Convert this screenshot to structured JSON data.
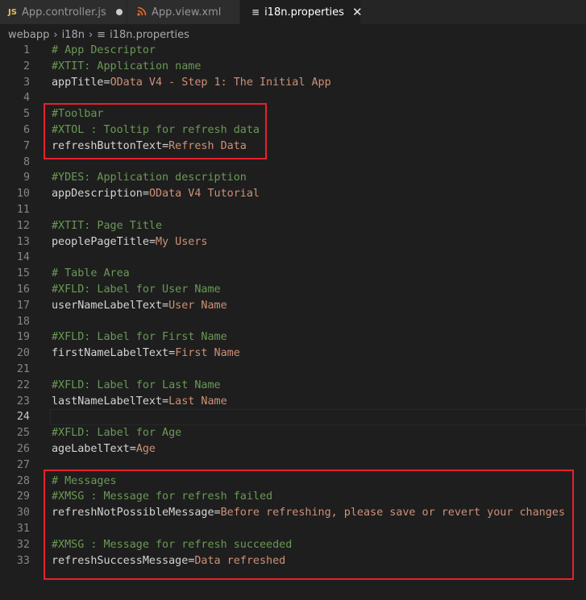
{
  "tabs": [
    {
      "icon_text": "JS",
      "icon_color": "#e0c356",
      "label": "App.controller.js",
      "modified": true,
      "active": false
    },
    {
      "icon_text": "rss",
      "icon_color": "#f06a2a",
      "label": "App.view.xml",
      "modified": false,
      "active": false
    },
    {
      "icon_text": "≡",
      "icon_color": "#cccccc",
      "label": "i18n.properties",
      "modified": false,
      "active": true
    }
  ],
  "breadcrumb": {
    "items": [
      "webapp",
      "i18n",
      "i18n.properties"
    ],
    "separator": "›"
  },
  "editor": {
    "current_line": 24,
    "lines": [
      {
        "n": "1",
        "comment": "# App Descriptor"
      },
      {
        "n": "2",
        "comment": "#XTIT: Application name"
      },
      {
        "n": "3",
        "key": "appTitle",
        "value": "OData V4 - Step 1: The Initial App"
      },
      {
        "n": "4"
      },
      {
        "n": "5",
        "comment": "#Toolbar"
      },
      {
        "n": "6",
        "comment": "#XTOL : Tooltip for refresh data"
      },
      {
        "n": "7",
        "key": "refreshButtonText",
        "value": "Refresh Data"
      },
      {
        "n": "8"
      },
      {
        "n": "9",
        "comment": "#YDES: Application description"
      },
      {
        "n": "10",
        "key": "appDescription",
        "value": "OData V4 Tutorial"
      },
      {
        "n": "11"
      },
      {
        "n": "12",
        "comment": "#XTIT: Page Title"
      },
      {
        "n": "13",
        "key": "peoplePageTitle",
        "value": "My Users"
      },
      {
        "n": "14"
      },
      {
        "n": "15",
        "comment": "# Table Area"
      },
      {
        "n": "16",
        "comment": "#XFLD: Label for User Name"
      },
      {
        "n": "17",
        "key": "userNameLabelText",
        "value": "User Name"
      },
      {
        "n": "18"
      },
      {
        "n": "19",
        "comment": "#XFLD: Label for First Name"
      },
      {
        "n": "20",
        "key": "firstNameLabelText",
        "value": "First Name"
      },
      {
        "n": "21"
      },
      {
        "n": "22",
        "comment": "#XFLD: Label for Last Name"
      },
      {
        "n": "23",
        "key": "lastNameLabelText",
        "value": "Last Name"
      },
      {
        "n": "24"
      },
      {
        "n": "25",
        "comment": "#XFLD: Label for Age"
      },
      {
        "n": "26",
        "key": "ageLabelText",
        "value": "Age"
      },
      {
        "n": "27"
      },
      {
        "n": "28",
        "comment": "# Messages"
      },
      {
        "n": "29",
        "comment": "#XMSG : Message for refresh failed"
      },
      {
        "n": "30",
        "key": "refreshNotPossibleMessage",
        "value": "Before refreshing, please save or revert your changes"
      },
      {
        "n": "31"
      },
      {
        "n": "32",
        "comment": "#XMSG : Message for refresh succeeded"
      },
      {
        "n": "33",
        "key": "refreshSuccessMessage",
        "value": "Data refreshed"
      }
    ]
  },
  "colors": {
    "background": "#1e1e1e",
    "comment": "#6a9955",
    "key": "#d4d4d4",
    "value": "#ce9178",
    "highlight": "#e8202e"
  }
}
